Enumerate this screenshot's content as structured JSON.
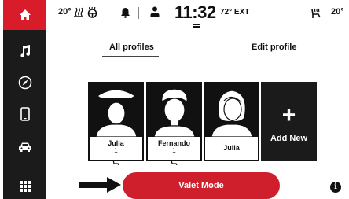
{
  "status_bar": {
    "left_temp": "20°",
    "clock": "11:32",
    "ext_temp": "72° EXT",
    "right_temp": "20°"
  },
  "tabs": {
    "all_profiles": "All profiles",
    "edit_profile": "Edit profile"
  },
  "profiles": [
    {
      "name": "Julia",
      "seat": "1"
    },
    {
      "name": "Fernando",
      "seat": "1"
    },
    {
      "name": "Julia",
      "seat": ""
    }
  ],
  "add_new": {
    "plus": "+",
    "label": "Add New"
  },
  "valet_button": "Valet Mode",
  "info_symbol": "i",
  "sidebar": {
    "items": [
      "home-icon",
      "music-icon",
      "compass-icon",
      "phone-icon",
      "car-icon",
      "apps-grid-icon"
    ],
    "active_color": "#d91c2a"
  },
  "colors": {
    "accent": "#cf1f2c",
    "rail": "#1b1b1b"
  }
}
